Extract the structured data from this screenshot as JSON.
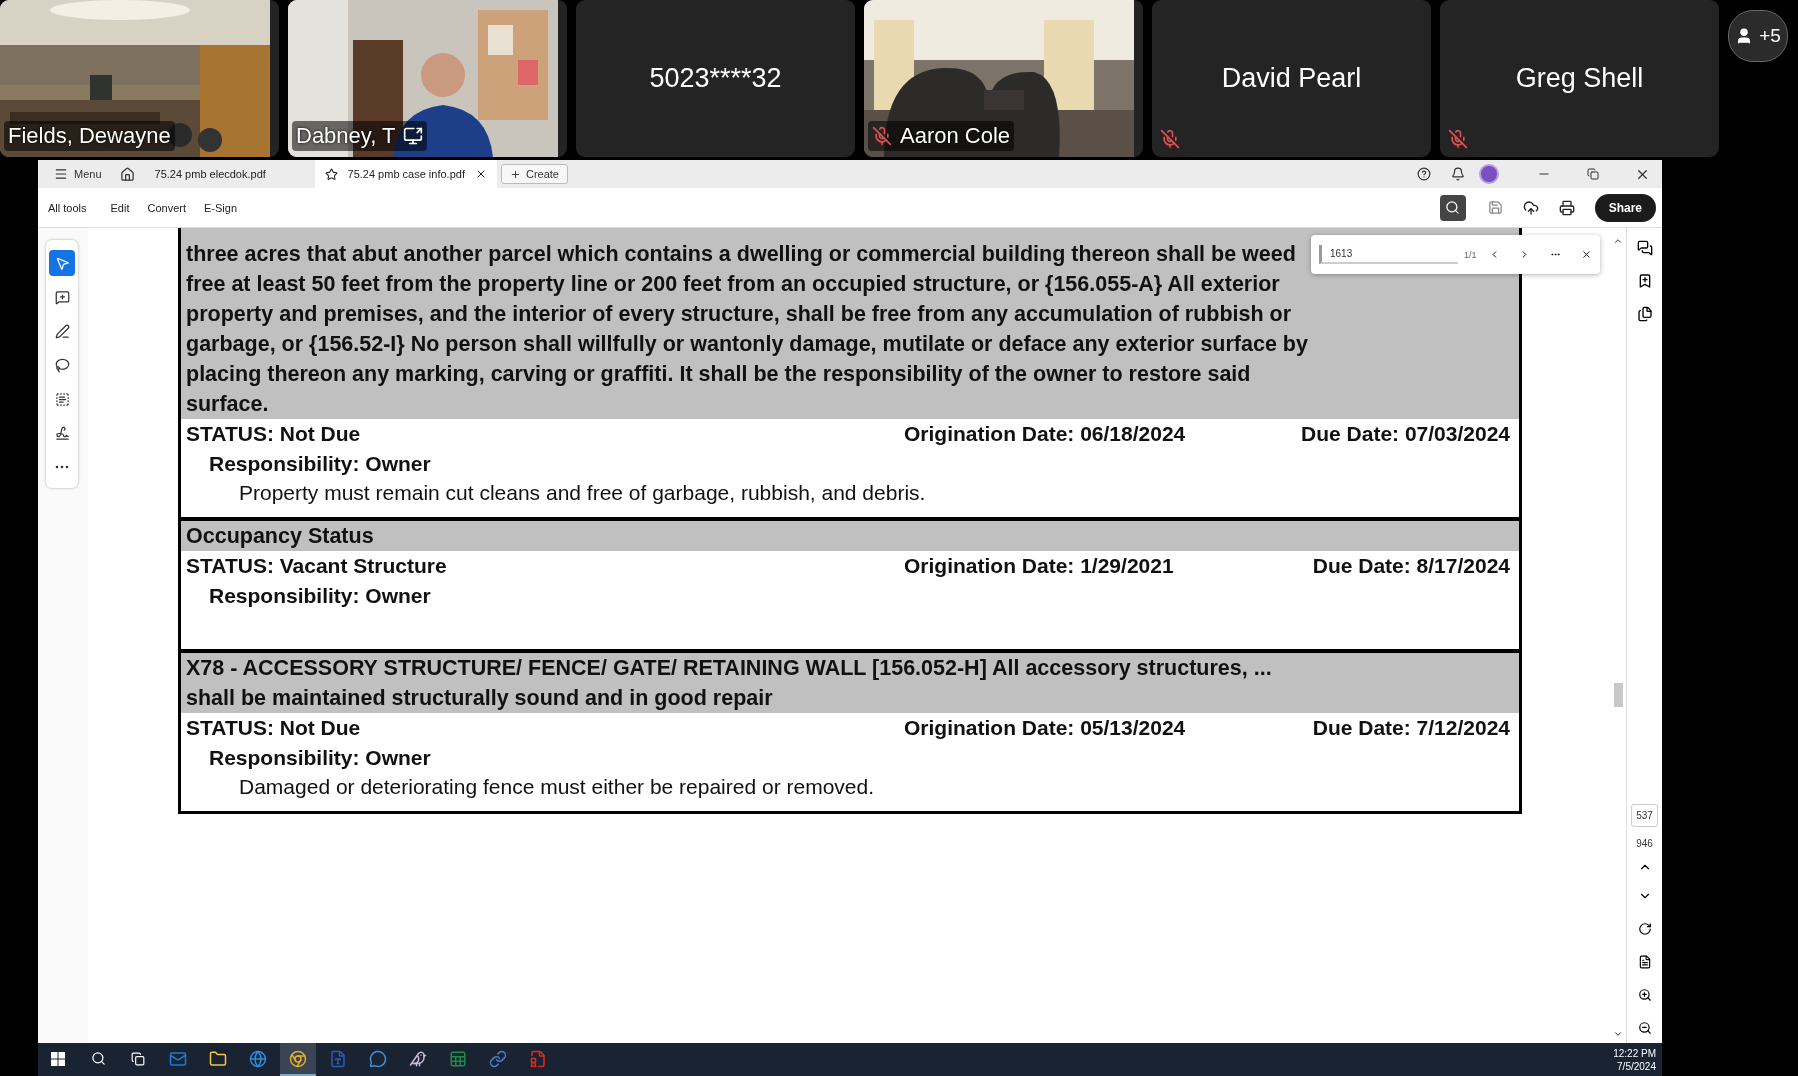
{
  "video_tiles": [
    {
      "kind": "video",
      "name": "Fields, Dewayne"
    },
    {
      "kind": "video",
      "name": "Dabney, T",
      "sharing": true
    },
    {
      "kind": "placeholder",
      "name": "5023****32"
    },
    {
      "kind": "video",
      "name": "Aaron Cole",
      "muted": true
    },
    {
      "kind": "placeholder",
      "name": "David Pearl",
      "muted": true
    },
    {
      "kind": "placeholder",
      "name": "Greg Shell",
      "muted": true
    }
  ],
  "participants_badge": "+5",
  "app": {
    "menu": "Menu",
    "tabs": [
      {
        "label": "75.24 pmb elecdok.pdf",
        "selected": false
      },
      {
        "label": "75.24 pmb case info.pdf",
        "selected": true
      }
    ],
    "create": "Create",
    "toolbar": [
      "All tools",
      "Edit",
      "Convert",
      "E-Sign"
    ],
    "share": "Share",
    "tools": [
      {
        "kind": "select",
        "selected": true
      },
      {
        "kind": "comment",
        "selected": false
      },
      {
        "kind": "draw",
        "selected": false
      },
      {
        "kind": "lasso",
        "selected": false
      },
      {
        "kind": "text",
        "selected": false
      },
      {
        "kind": "sign",
        "selected": false
      },
      {
        "kind": "more",
        "selected": false
      }
    ],
    "find": {
      "value": "1613",
      "count": "1/1"
    },
    "page_number": "537",
    "page_count": "946"
  },
  "document": {
    "sections": [
      {
        "heading": "three acres that abut another parcel which contains a dwelling or commercial building thereon shall be weed free at least 50 feet from the property line or 200 feet from an occupied structure, or {156.055-A} All exterior property and premises, and the interior of every structure, shall be free from any accumulation of rubbish or garbage, or {156.52-I} No person shall willfully or wantonly damage, mutilate or deface any exterior surface by placing thereon any marking, carving or graffiti. It shall be the responsibility of the owner to restore said surface.",
        "status": "STATUS: Not Due",
        "origination": "Origination Date: 06/18/2024",
        "due": "Due Date: 07/03/2024",
        "responsibility": "Responsibility: Owner",
        "note": "Property must remain cut cleans and free of garbage, rubbish, and debris."
      },
      {
        "heading": "Occupancy Status",
        "status": "STATUS: Vacant Structure",
        "origination": "Origination Date: 1/29/2021",
        "due": "Due Date: 8/17/2024",
        "responsibility": "Responsibility: Owner"
      },
      {
        "heading": "X78 - ACCESSORY STRUCTURE/ FENCE/ GATE/ RETAINING WALL  [156.052-H] All accessory structures, ... shall be maintained structurally sound and in good repair",
        "status": "STATUS: Not Due",
        "origination": "Origination Date: 05/13/2024",
        "due": "Due Date: 7/12/2024",
        "responsibility": "Responsibility: Owner",
        "note": "Damaged or deteriorating fence must either be repaired or removed."
      }
    ]
  },
  "taskbar": {
    "apps": [
      {
        "kind": "mail",
        "selected": false
      },
      {
        "kind": "folder",
        "selected": false
      },
      {
        "kind": "globe",
        "selected": false
      },
      {
        "kind": "browser",
        "selected": true
      },
      {
        "kind": "doc",
        "selected": false
      },
      {
        "kind": "chat",
        "selected": false
      },
      {
        "kind": "bird",
        "selected": false
      },
      {
        "kind": "sheet",
        "selected": false
      },
      {
        "kind": "link",
        "selected": false
      },
      {
        "kind": "pdf",
        "selected": false
      }
    ],
    "time": "12:22 PM",
    "date": "7/5/2024"
  }
}
